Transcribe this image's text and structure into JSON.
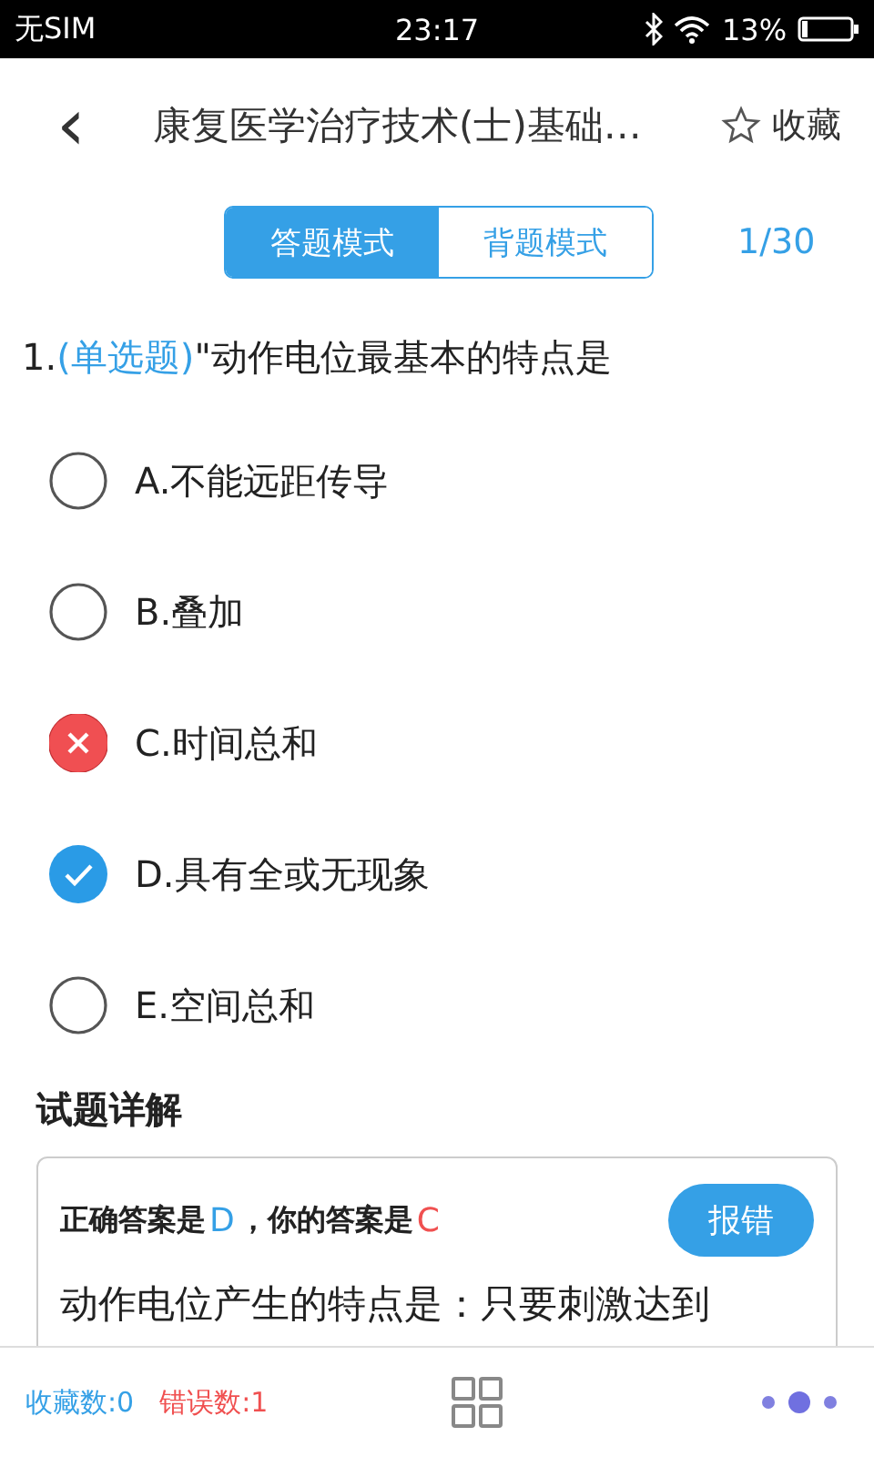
{
  "status_bar": {
    "carrier": "无SIM",
    "time": "23:17",
    "battery": "13%"
  },
  "header": {
    "back": "‹",
    "title": "康复医学治疗技术(士)基础…",
    "favorite": "收藏"
  },
  "mode_tabs": [
    {
      "label": "答题模式",
      "selected": true
    },
    {
      "label": "背题模式",
      "selected": false
    }
  ],
  "progress": "1/30",
  "question": {
    "number": "1.",
    "type": "(单选题)",
    "text": "\"动作电位最基本的特点是"
  },
  "options": [
    {
      "label": "A.不能远距传导",
      "kind": "plain",
      "selected": false
    },
    {
      "label": "B.叠加",
      "kind": "plain",
      "selected": false
    },
    {
      "label": "C.时间总和",
      "kind": "wrong",
      "selected": true
    },
    {
      "label": "D.具有全或无现象",
      "kind": "correct",
      "selected": false
    },
    {
      "label": "E.空间总和",
      "kind": "plain",
      "selected": false
    }
  ],
  "explanation": {
    "title": "试题详解",
    "correct_label": "正确答案是",
    "correct_answer": "D",
    "your_label": "，你的答案是",
    "your_answer": "C",
    "report_button": "报错",
    "text": "动作电位产生的特点是：只要刺激达到"
  },
  "bottom_bar": {
    "favorites": "收藏数:0",
    "errors": "错误数:1"
  }
}
